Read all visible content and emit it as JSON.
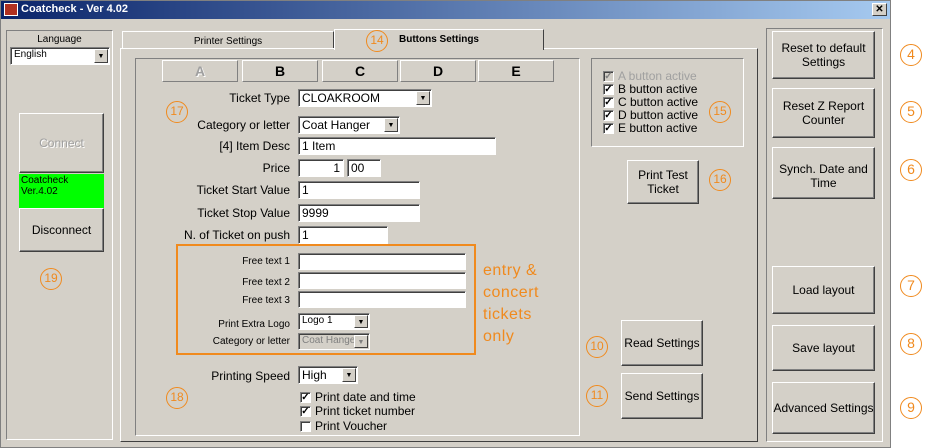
{
  "window": {
    "title": "Coatcheck - Ver 4.02",
    "close_glyph": "✕"
  },
  "left": {
    "language_label": "Language",
    "language_value": "English",
    "connect_label": "Connect",
    "status_text": "Coatcheck Ver.4.02",
    "status_color": "#00ff00",
    "disconnect_label": "Disconnect"
  },
  "tabs": [
    {
      "label": "Printer Settings",
      "active": false
    },
    {
      "label": "Buttons Settings",
      "active": true
    }
  ],
  "letter_tabs": [
    "A",
    "B",
    "C",
    "D",
    "E"
  ],
  "form": {
    "ticket_type_label": "Ticket Type",
    "ticket_type_value": "CLOAKROOM",
    "category_label": "Category or letter",
    "category_value": "Coat Hanger",
    "item_desc_label": "[4] Item Desc",
    "item_desc_value": "1 Item",
    "price_label": "Price",
    "price_whole": "1",
    "price_cents": "00",
    "start_label": "Ticket Start Value",
    "start_value": "1",
    "stop_label": "Ticket Stop Value",
    "stop_value": "9999",
    "push_label": "N. of Ticket on push",
    "push_value": "1"
  },
  "extra": {
    "free1_label": "Free text 1",
    "free1_value": "",
    "free2_label": "Free text 2",
    "free2_value": "",
    "free3_label": "Free text 3",
    "free3_value": "",
    "logo_label": "Print Extra Logo",
    "logo_value": "Logo 1",
    "cat_label": "Category or letter",
    "cat_value": "Coat Hanger"
  },
  "note_lines": [
    "entry &",
    "concert",
    "tickets",
    "only"
  ],
  "printing": {
    "speed_label": "Printing Speed",
    "speed_value": "High",
    "opt1": "Print date and time",
    "opt2": "Print ticket number",
    "opt3": "Print Voucher"
  },
  "active_buttons": [
    {
      "label": "A button active",
      "checked": true,
      "disabled": true
    },
    {
      "label": "B button active",
      "checked": true,
      "disabled": false
    },
    {
      "label": "C button active",
      "checked": true,
      "disabled": false
    },
    {
      "label": "D button active",
      "checked": true,
      "disabled": false
    },
    {
      "label": "E button active",
      "checked": true,
      "disabled": false
    }
  ],
  "buttons": {
    "print_test": "Print Test\nTicket",
    "read_settings": "Read Settings",
    "send_settings": "Send Settings",
    "reset_default": "Reset to default\nSettings",
    "reset_z": "Reset Z Report\nCounter",
    "synch": "Synch. Date and\nTime",
    "load_layout": "Load layout",
    "save_layout": "Save layout",
    "advanced": "Advanced Settings"
  },
  "badges": [
    "4",
    "5",
    "6",
    "7",
    "8",
    "9",
    "10",
    "11",
    "14",
    "15",
    "16",
    "17",
    "18",
    "19"
  ],
  "colors": {
    "annotation": "#f08a1e",
    "title_bar": "#0a246a",
    "status_green": "#00ff00"
  }
}
